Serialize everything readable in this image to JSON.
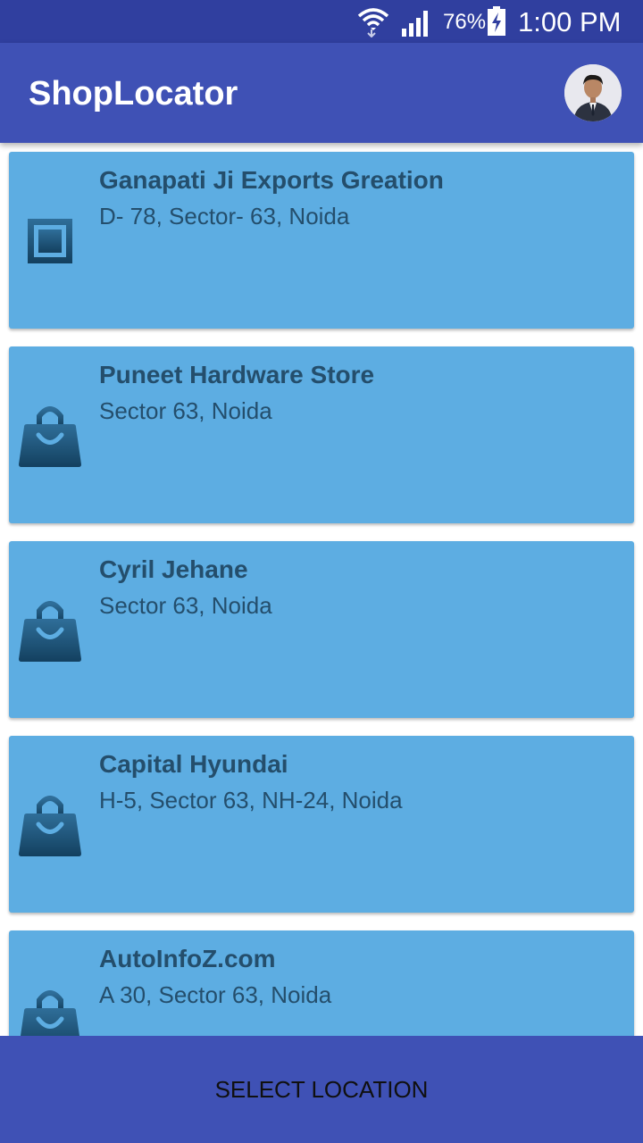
{
  "status_bar": {
    "battery_percent": "76%",
    "time": "1:00 PM",
    "icons": [
      "wifi-icon",
      "signal-icon",
      "battery-charging-icon"
    ]
  },
  "app_bar": {
    "title": "ShopLocator",
    "avatar": "user-avatar"
  },
  "shops": [
    {
      "name": "Ganapati Ji Exports Greation",
      "address": "D- 78, Sector- 63, Noida",
      "icon": "square-store-icon"
    },
    {
      "name": "Puneet Hardware Store",
      "address": "Sector 63, Noida",
      "icon": "shopping-bag-icon"
    },
    {
      "name": "Cyril Jehane",
      "address": "Sector 63, Noida",
      "icon": "shopping-bag-icon"
    },
    {
      "name": "Capital Hyundai",
      "address": "H-5, Sector 63, NH-24, Noida",
      "icon": "shopping-bag-icon"
    },
    {
      "name": "AutoInfoZ.com",
      "address": "A 30, Sector 63, Noida",
      "icon": "shopping-bag-icon"
    }
  ],
  "bottom": {
    "button_label": "SELECT LOCATION"
  },
  "colors": {
    "status_bar": "#303F9F",
    "app_bar": "#3F51B5",
    "card": "#5DADE2",
    "card_text": "#244E6C"
  }
}
